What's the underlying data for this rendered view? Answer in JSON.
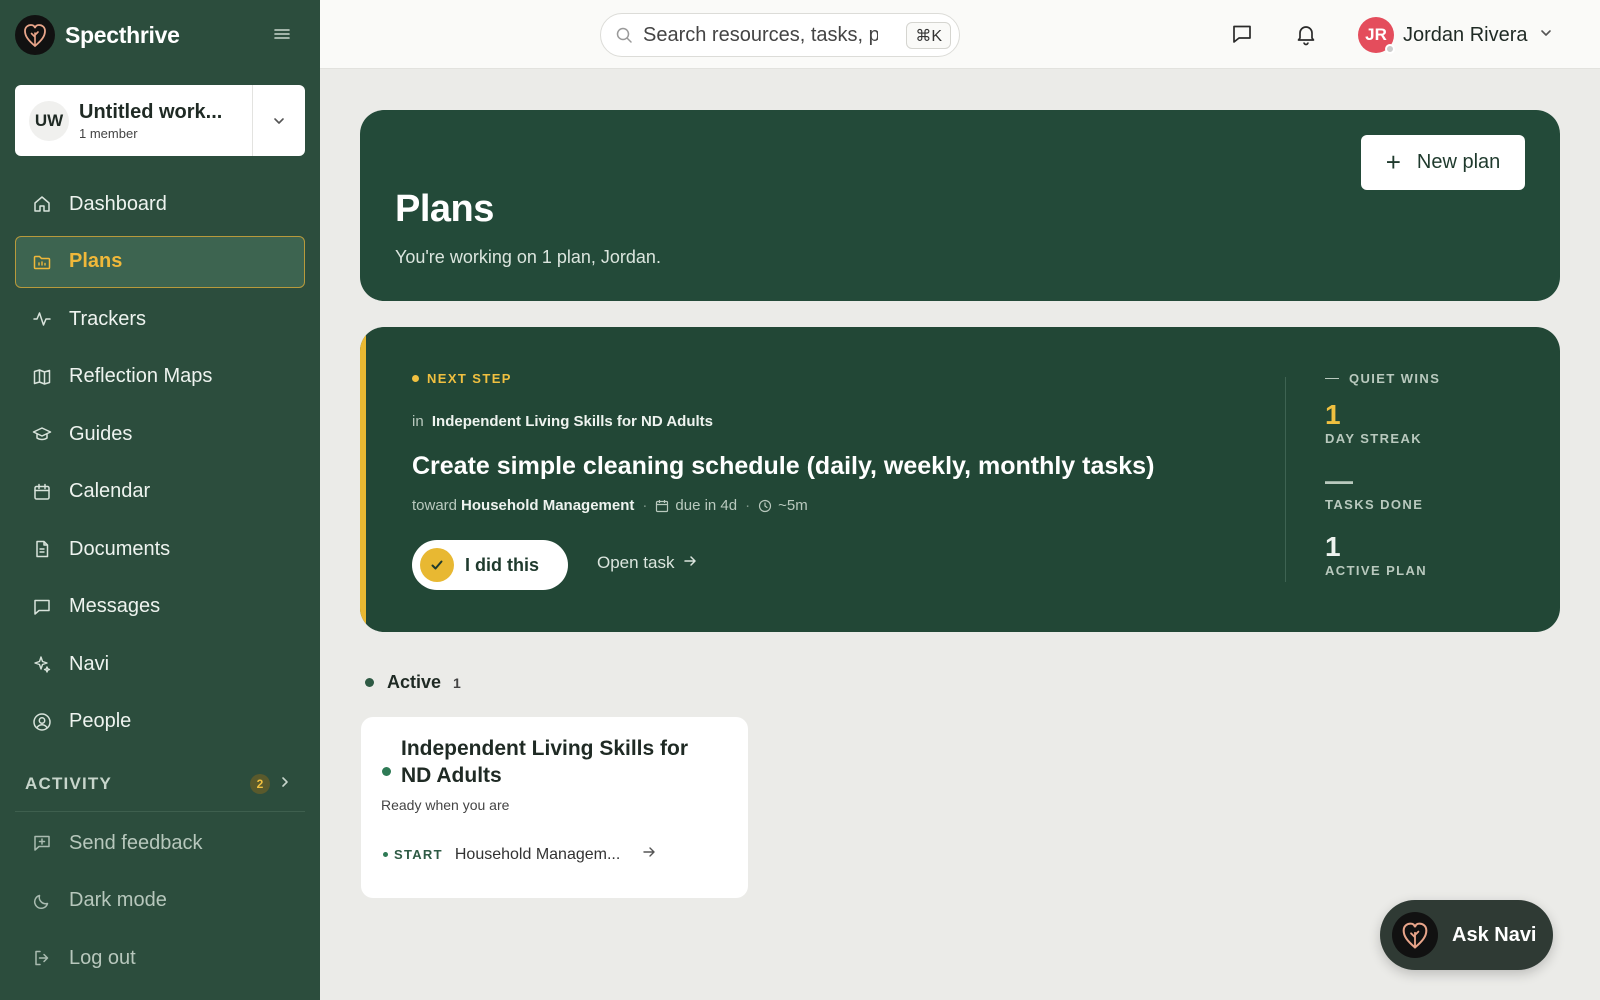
{
  "brand": {
    "name": "Specthrive"
  },
  "workspace": {
    "initials": "UW",
    "name": "Untitled work...",
    "members": "1 member"
  },
  "nav": {
    "items": [
      {
        "label": "Dashboard",
        "icon": "home-icon"
      },
      {
        "label": "Plans",
        "icon": "folder-icon",
        "active": true
      },
      {
        "label": "Trackers",
        "icon": "activity-icon"
      },
      {
        "label": "Reflection Maps",
        "icon": "map-icon"
      },
      {
        "label": "Guides",
        "icon": "graduation-cap-icon"
      },
      {
        "label": "Calendar",
        "icon": "calendar-icon"
      },
      {
        "label": "Documents",
        "icon": "document-icon"
      },
      {
        "label": "Messages",
        "icon": "message-icon"
      },
      {
        "label": "Navi",
        "icon": "sparkles-icon"
      },
      {
        "label": "People",
        "icon": "user-circle-icon"
      }
    ],
    "activity": {
      "label": "ACTIVITY",
      "count": "2"
    },
    "bottom": [
      {
        "label": "Send feedback",
        "icon": "feedback-icon"
      },
      {
        "label": "Dark mode",
        "icon": "moon-icon"
      },
      {
        "label": "Log out",
        "icon": "logout-icon"
      }
    ]
  },
  "topbar": {
    "search_placeholder": "Search resources, tasks, people...",
    "shortcut": "⌘K",
    "user": {
      "initials": "JR",
      "name": "Jordan Rivera",
      "avatar_color": "#e44d5c"
    }
  },
  "plans_header": {
    "title": "Plans",
    "subtitle": "You're working on 1 plan, Jordan.",
    "new_plan_label": "New plan"
  },
  "next_step": {
    "eyebrow": "NEXT STEP",
    "in_prefix": "in",
    "plan_name": "Independent Living Skills for ND Adults",
    "task_title": "Create simple cleaning schedule (daily, weekly, monthly tasks)",
    "toward_prefix": "toward",
    "goal": "Household Management",
    "due": "due in 4d",
    "duration": "~5m",
    "did_this_label": "I did this",
    "open_task_label": "Open task"
  },
  "quiet_wins": {
    "title": "QUIET WINS",
    "day_streak": {
      "value": "1",
      "label": "DAY STREAK"
    },
    "tasks_done": {
      "value": "—",
      "label": "TASKS DONE"
    },
    "active_plan": {
      "value": "1",
      "label": "ACTIVE PLAN"
    }
  },
  "active_section": {
    "label": "Active",
    "count": "1",
    "plans": [
      {
        "title": "Independent Living Skills for ND Adults",
        "status": "Ready when you are",
        "start_label": "START",
        "start_goal": "Household Managem..."
      }
    ]
  },
  "ask_navi": {
    "label": "Ask Navi"
  },
  "colors": {
    "sidebar": "#2c4d3d",
    "card": "#224736",
    "accent": "#e8b832",
    "active_text": "#f0b83a"
  }
}
